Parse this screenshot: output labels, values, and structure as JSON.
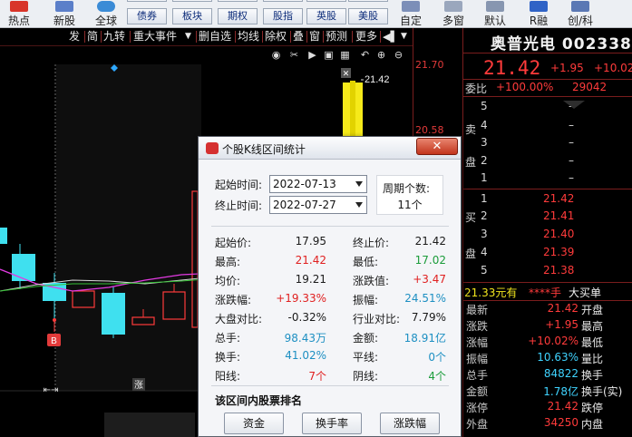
{
  "toolbar": {
    "items": [
      {
        "label": "热点"
      },
      {
        "label": "新股"
      },
      {
        "label": "全球"
      },
      {
        "label": "自定"
      },
      {
        "label": "多窗"
      },
      {
        "label": "默认"
      },
      {
        "label": "R融"
      },
      {
        "label": "创/科"
      }
    ],
    "sub_buttons": [
      {
        "label": "债券"
      },
      {
        "label": "板块"
      },
      {
        "label": "期权"
      },
      {
        "label": "股指"
      },
      {
        "label": "英股"
      },
      {
        "label": "美股"
      }
    ]
  },
  "chart_menu": {
    "items": [
      "发",
      "简",
      "九转",
      "重大事件",
      "删自选",
      "均线",
      "除权",
      "叠",
      "窗",
      "预测",
      "更多"
    ]
  },
  "price_axis": {
    "top_label": "21.70",
    "mid_label": "20.58"
  },
  "chart_annotations": {
    "last_price": "21.42",
    "buy_marker": "B",
    "up_marker": "涨"
  },
  "quote": {
    "name_code": "奥普光电 002338",
    "price": "21.42",
    "change": "+1.95",
    "change_pct": "+10.02",
    "wei_bi_label": "委比",
    "wei_bi_value": "+100.00%",
    "wei_cha": "29042",
    "sell_side": "卖盘",
    "sell": [
      {
        "lvl": "5",
        "price": "–"
      },
      {
        "lvl": "4",
        "price": "–"
      },
      {
        "lvl": "3",
        "price": "–"
      },
      {
        "lvl": "2",
        "price": "–"
      },
      {
        "lvl": "1",
        "price": "–"
      }
    ],
    "buy_side": "买盘",
    "buy": [
      {
        "lvl": "1",
        "price": "21.42"
      },
      {
        "lvl": "2",
        "price": "21.41"
      },
      {
        "lvl": "3",
        "price": "21.40"
      },
      {
        "lvl": "4",
        "price": "21.39"
      },
      {
        "lvl": "5",
        "price": "21.38"
      }
    ],
    "bid_line": {
      "price": "21.33元有",
      "qty": "****手",
      "label": "大买单"
    },
    "stats": [
      {
        "label": "最新",
        "value": "21.42",
        "label2": "开盘",
        "color": "#ff3b3b"
      },
      {
        "label": "涨跌",
        "value": "+1.95",
        "label2": "最高",
        "color": "#ff3b3b"
      },
      {
        "label": "涨幅",
        "value": "+10.02%",
        "label2": "最低",
        "color": "#ff3b3b"
      },
      {
        "label": "振幅",
        "value": "10.63%",
        "label2": "量比",
        "color": "#3fd3ff"
      },
      {
        "label": "总手",
        "value": "84822",
        "label2": "换手",
        "color": "#3fd3ff"
      },
      {
        "label": "金额",
        "value": "1.78亿",
        "label2": "换手(实)",
        "color": "#3fd3ff"
      },
      {
        "label": "涨停",
        "value": "21.42",
        "label2": "跌停",
        "color": "#ff3b3b"
      },
      {
        "label": "外盘",
        "value": "34250",
        "label2": "内盘",
        "color": "#ff3b3b"
      }
    ]
  },
  "dialog": {
    "title": "个股K线区间统计",
    "close": "✕",
    "start_label": "起始时间:",
    "start_value": "2022-07-13",
    "end_label": "终止时间:",
    "end_value": "2022-07-27",
    "period_label": "周期个数:",
    "period_value": "11个",
    "stats": [
      {
        "l1": "起始价:",
        "v1": "17.95",
        "c1": "#1a1a1a",
        "l2": "终止价:",
        "v2": "21.42",
        "c2": "#1a1a1a"
      },
      {
        "l1": "最高:",
        "v1": "21.42",
        "c1": "#e02020",
        "l2": "最低:",
        "v2": "17.02",
        "c2": "#1b9c3a"
      },
      {
        "l1": "均价:",
        "v1": "19.21",
        "c1": "#1a1a1a",
        "l2": "涨跌值:",
        "v2": "+3.47",
        "c2": "#e02020"
      },
      {
        "l1": "涨跌幅:",
        "v1": "+19.33%",
        "c1": "#e02020",
        "l2": "振幅:",
        "v2": "24.51%",
        "c2": "#1d8fc2"
      },
      {
        "l1": "大盘对比:",
        "v1": "-0.32%",
        "c1": "#1a1a1a",
        "l2": "行业对比:",
        "v2": "7.79%",
        "c2": "#1a1a1a"
      },
      {
        "l1": "总手:",
        "v1": "98.43万",
        "c1": "#1d8fc2",
        "l2": "金额:",
        "v2": "18.91亿",
        "c2": "#1d8fc2"
      },
      {
        "l1": "换手:",
        "v1": "41.02%",
        "c1": "#1d8fc2",
        "l2": "平线:",
        "v2": "0个",
        "c2": "#1d8fc2"
      },
      {
        "l1": "阳线:",
        "v1": "7个",
        "c1": "#e02020",
        "l2": "阴线:",
        "v2": "4个",
        "c2": "#1b9c3a"
      }
    ],
    "section_title": "该区间内股票排名",
    "buttons": [
      {
        "label": "资金"
      },
      {
        "label": "换手率"
      },
      {
        "label": "涨跌幅"
      }
    ]
  }
}
